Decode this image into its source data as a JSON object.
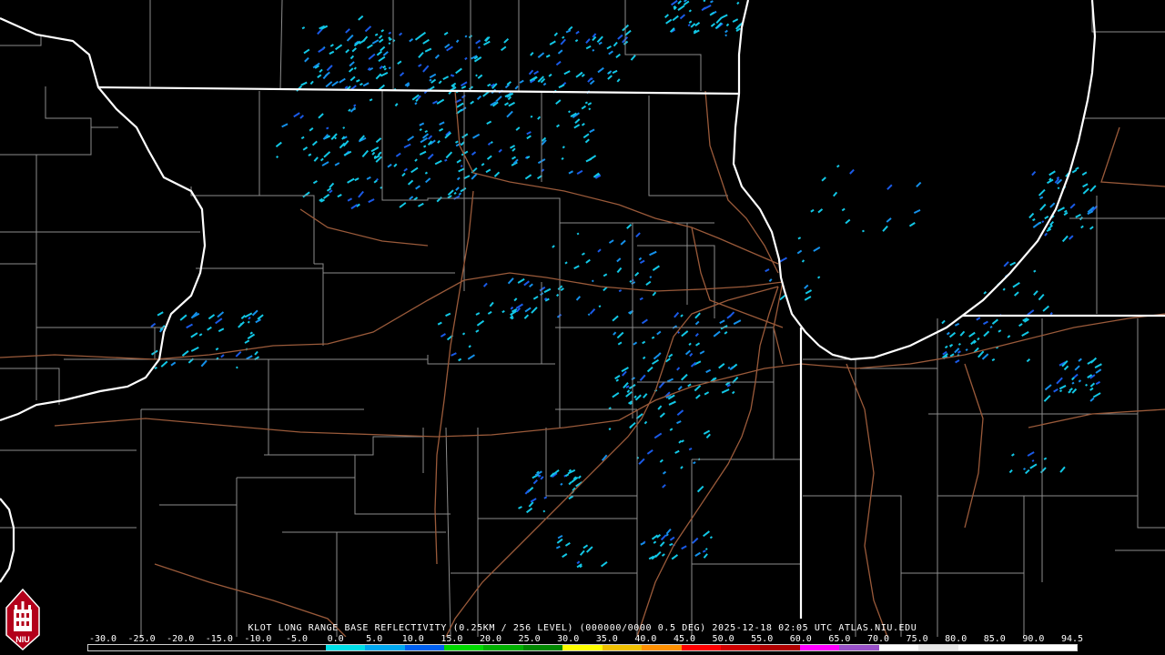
{
  "product": {
    "caption": "KLOT LONG RANGE BASE REFLECTIVITY (0.25KM / 256 LEVEL) (000000/0000 0.5 DEG) 2025-12-18 02:05 UTC  ATLAS.NIU.EDU",
    "logo_text": "NIU"
  },
  "scale": {
    "labels": [
      "-30.0",
      "-25.0",
      "-20.0",
      "-15.0",
      "-10.0",
      "-5.0",
      "0.0",
      "5.0",
      "10.0",
      "15.0",
      "20.0",
      "25.0",
      "30.0",
      "35.0",
      "40.0",
      "45.0",
      "50.0",
      "55.0",
      "60.0",
      "65.0",
      "70.0",
      "75.0",
      "80.0",
      "85.0",
      "90.0",
      "94.5"
    ],
    "segment_colors": [
      "#000000",
      "#000000",
      "#000000",
      "#000000",
      "#000000",
      "#000000",
      "#00e0e8",
      "#00a8f0",
      "#0060f0",
      "#00d800",
      "#00b000",
      "#008800",
      "#ffff00",
      "#f0c000",
      "#ff9000",
      "#ff0000",
      "#d00000",
      "#b00000",
      "#ff00ff",
      "#9850c8",
      "#ffffff",
      "#e8e8e8",
      "#ffffff",
      "#ffffff",
      "#ffffff"
    ]
  },
  "colors": {
    "background": "#000000",
    "state_border": "#ffffff",
    "county_line": "#8c8c8c",
    "highway": "#9a5a3a",
    "echo_light": "#12c8e6",
    "echo_medium": "#1490ea",
    "echo_strong": "#1a5ae8"
  }
}
